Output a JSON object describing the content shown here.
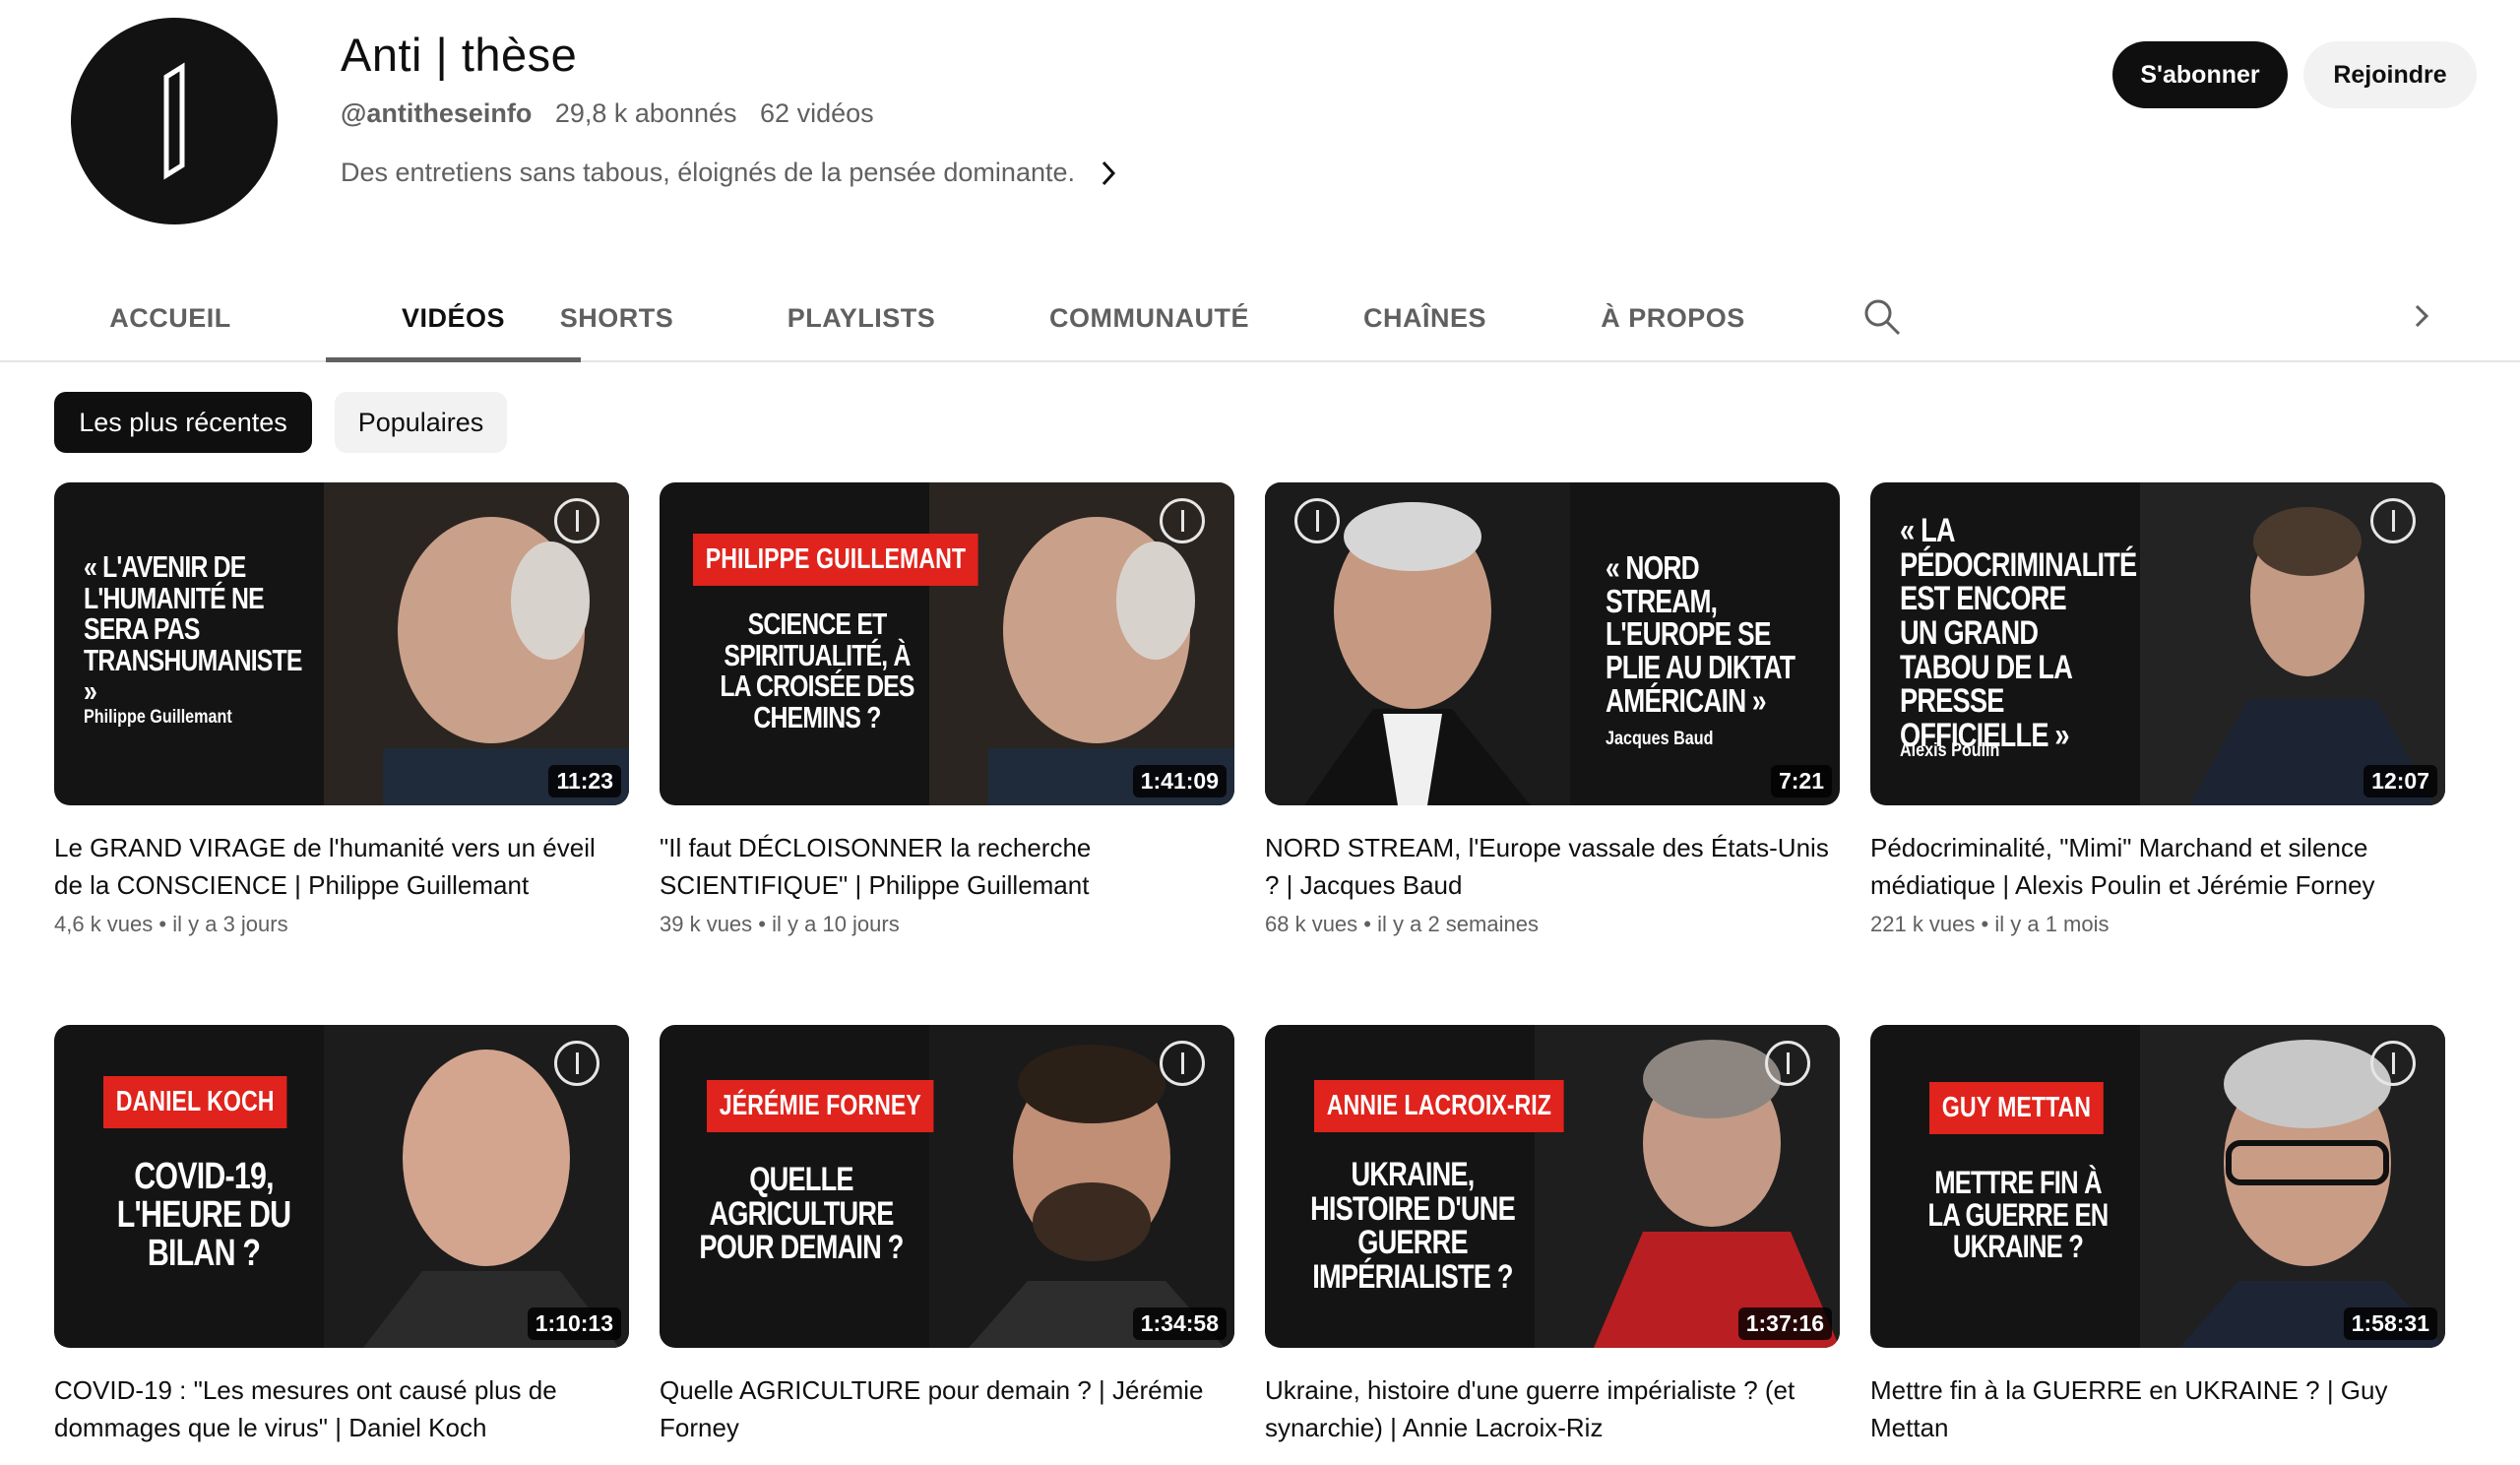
{
  "channel": {
    "name": "Anti | thèse",
    "handle": "@antitheseinfo",
    "subscribers": "29,8 k abonnés",
    "video_count": "62 vidéos",
    "description": "Des entretiens sans tabous, éloignés de la pensée dominante.",
    "subscribe_label": "S'abonner",
    "join_label": "Rejoindre"
  },
  "tabs": [
    "ACCUEIL",
    "VIDÉOS",
    "SHORTS",
    "PLAYLISTS",
    "COMMUNAUTÉ",
    "CHAÎNES",
    "À PROPOS"
  ],
  "active_tab": "VIDÉOS",
  "filters": {
    "recent": "Les plus récentes",
    "popular": "Populaires"
  },
  "videos": [
    {
      "thumb_text": "« L'AVENIR DE L'HUMANITÉ NE SERA PAS TRANSHUMANISTE »",
      "thumb_credit": "Philippe Guillemant",
      "duration": "11:23",
      "title": "Le GRAND VIRAGE de l'humanité vers un éveil de la CONSCIENCE | Philippe Guillemant",
      "views": "4,6 k vues",
      "age": "il y a 3 jours"
    },
    {
      "thumb_tag": "PHILIPPE GUILLEMANT",
      "thumb_text": "SCIENCE ET SPIRITUALITÉ, À LA CROISÉE DES CHEMINS ?",
      "duration": "1:41:09",
      "title": "\"Il faut DÉCLOISONNER la recherche SCIENTIFIQUE\" | Philippe Guillemant",
      "views": "39 k vues",
      "age": "il y a 10 jours"
    },
    {
      "thumb_text": "« NORD STREAM, L'EUROPE SE PLIE AU DIKTAT AMÉRICAIN »",
      "thumb_credit": "Jacques Baud",
      "duration": "7:21",
      "title": "NORD STREAM, l'Europe vassale des États-Unis ? | Jacques Baud",
      "views": "68 k vues",
      "age": "il y a 2 semaines"
    },
    {
      "thumb_text": "« LA PÉDOCRIMINALITÉ EST ENCORE UN GRAND TABOU DE LA PRESSE OFFICIELLE »",
      "thumb_credit": "Alexis Poulin",
      "duration": "12:07",
      "title": "Pédocriminalité, \"Mimi\" Marchand et silence médiatique | Alexis Poulin et Jérémie Forney",
      "views": "221 k vues",
      "age": "il y a 1 mois"
    },
    {
      "thumb_tag": "DANIEL KOCH",
      "thumb_text": "COVID-19, L'HEURE DU BILAN ?",
      "duration": "1:10:13",
      "title": "COVID-19 : \"Les mesures ont causé plus de dommages que le virus\" | Daniel Koch"
    },
    {
      "thumb_tag": "JÉRÉMIE FORNEY",
      "thumb_text": "QUELLE AGRICULTURE POUR DEMAIN ?",
      "duration": "1:34:58",
      "title": "Quelle AGRICULTURE pour demain ? | Jérémie Forney"
    },
    {
      "thumb_tag": "ANNIE LACROIX-RIZ",
      "thumb_text": "UKRAINE, HISTOIRE D'UNE GUERRE IMPÉRIALISTE ?",
      "duration": "1:37:16",
      "title": "Ukraine, histoire d'une guerre impérialiste ? (et synarchie) | Annie Lacroix-Riz"
    },
    {
      "thumb_tag": "GUY METTAN",
      "thumb_text": "METTRE FIN À LA GUERRE EN UKRAINE ?",
      "duration": "1:58:31",
      "title": "Mettre fin à la GUERRE en UKRAINE ? | Guy Mettan"
    }
  ],
  "colors": {
    "accent_red": "#e0231c",
    "text_primary": "#0f0f0f",
    "text_secondary": "#606060",
    "chip_bg": "#f2f2f2"
  },
  "icons": [
    "channel-logo-icon",
    "chevron-right-icon",
    "search-icon",
    "play-timer-icon"
  ]
}
